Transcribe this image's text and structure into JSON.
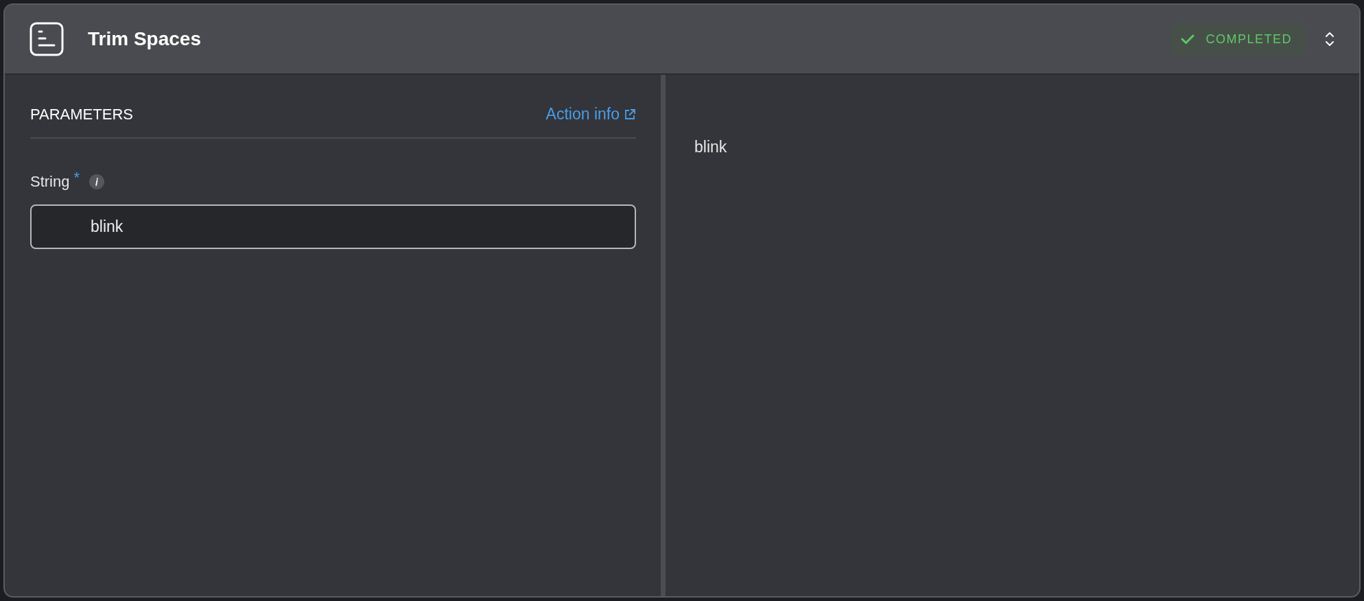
{
  "header": {
    "title": "Trim Spaces",
    "status": {
      "label": "COMPLETED",
      "kind": "success"
    }
  },
  "parameters": {
    "heading": "PARAMETERS",
    "link": "Action info",
    "fields": [
      {
        "label": "String",
        "required_mark": "*",
        "value": "blink"
      }
    ]
  },
  "output": {
    "text": "blink"
  }
}
